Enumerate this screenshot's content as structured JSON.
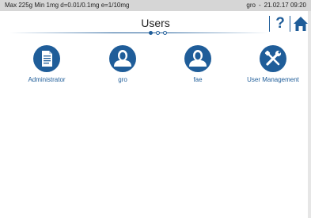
{
  "status_bar": {
    "max": "Max 225g",
    "min": "Min 1mg",
    "d": "d=0.01/0.1mg",
    "e": "e=1/10mg",
    "user": "gro",
    "separator": "-",
    "datetime": "21.02.17 09:20"
  },
  "header": {
    "title": "Users",
    "help_label": "?",
    "home_icon": "home-icon",
    "pages": {
      "count": 3,
      "active": 1
    }
  },
  "tiles": [
    {
      "label": "Administrator",
      "icon": "document-icon"
    },
    {
      "label": "gro",
      "icon": "user-icon"
    },
    {
      "label": "fae",
      "icon": "user-icon"
    },
    {
      "label": "User Management",
      "icon": "tools-icon"
    }
  ],
  "colors": {
    "accent": "#1f5d99",
    "status_bar_bg": "#d6d6d6"
  }
}
